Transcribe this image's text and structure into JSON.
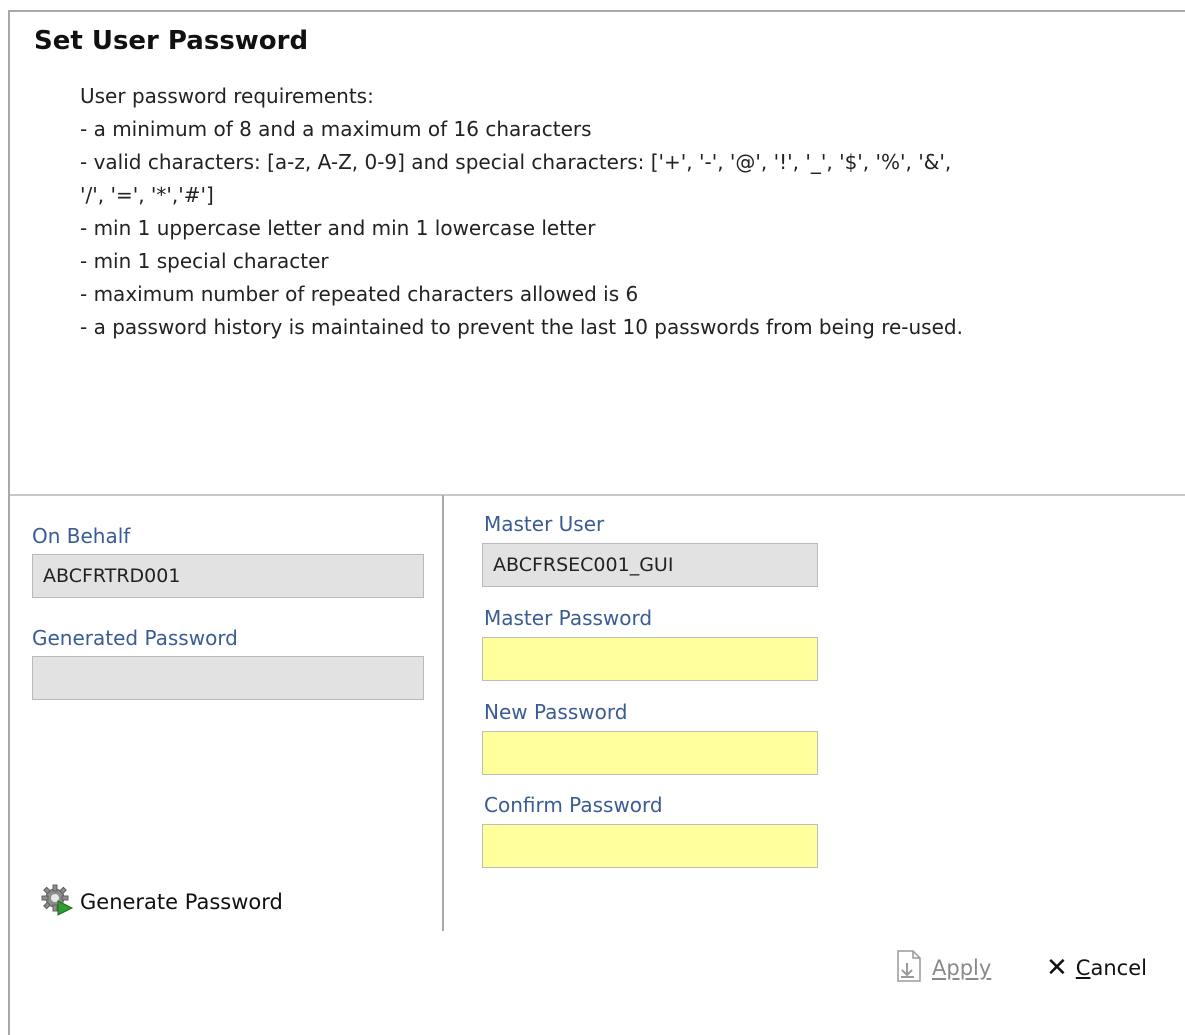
{
  "dialog": {
    "title": "Set User Password",
    "requirements": [
      "User password requirements:",
      "- a minimum of 8 and a maximum of 16 characters",
      "- valid characters: [a-z, A-Z, 0-9] and special characters: ['+', '-', '@', '!', '_', '$', '%', '&',",
      "'/', '=', '*','#']",
      "- min 1 uppercase letter and min 1 lowercase letter",
      "- min 1 special character",
      "- maximum number of repeated characters allowed is 6",
      "- a password history is maintained to prevent the last 10 passwords from being re-used."
    ]
  },
  "left": {
    "on_behalf_label": "On Behalf",
    "on_behalf_value": "ABCFRTRD001",
    "generated_password_label": "Generated Password",
    "generated_password_value": "",
    "generate_button_label": "Generate Password",
    "generate_icon": "gear-play-icon"
  },
  "right": {
    "master_user_label": "Master User",
    "master_user_value": "ABCFRSEC001_GUI",
    "master_password_label": "Master Password",
    "master_password_value": "",
    "new_password_label": "New Password",
    "new_password_value": "",
    "confirm_password_label": "Confirm Password",
    "confirm_password_value": ""
  },
  "actions": {
    "apply_label": "Apply",
    "apply_icon": "apply-document-icon",
    "cancel_label_first": "C",
    "cancel_label_rest": "ancel",
    "cancel_icon": "close-icon"
  },
  "colors": {
    "label_blue": "#3a5c94",
    "readonly_field": "#e2e2e2",
    "required_field": "#ffff9c"
  }
}
